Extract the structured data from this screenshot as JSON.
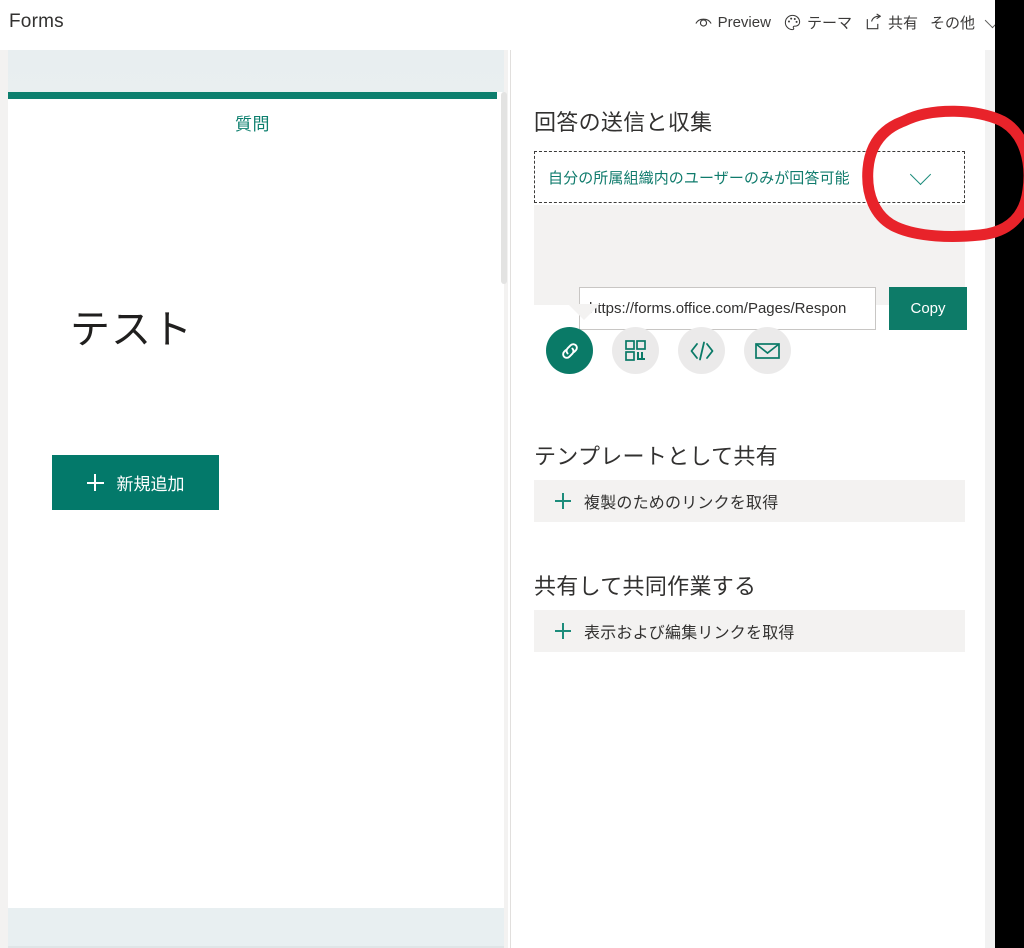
{
  "header": {
    "brand": "Forms",
    "actions": [
      {
        "label": "Preview",
        "icon": "eye-icon"
      },
      {
        "label": "テーマ",
        "icon": "palette-icon"
      },
      {
        "label": "共有",
        "icon": "share-icon"
      },
      {
        "label": "その他",
        "icon": "chevron-down-icon"
      }
    ]
  },
  "form": {
    "tab_label": "質問",
    "title": "テスト",
    "add_button": "新規追加"
  },
  "share_panel": {
    "send_section_title": "回答の送信と収集",
    "audience_value": "自分の所属組織内のユーザーのみが回答可能",
    "link_url": "https://forms.office.com/Pages/Respon",
    "copy_button": "Copy",
    "share_methods": [
      {
        "name": "link-icon",
        "label": "リンク",
        "selected": true
      },
      {
        "name": "qr-code-icon",
        "label": "QR コード",
        "selected": false
      },
      {
        "name": "embed-code-icon",
        "label": "埋め込み",
        "selected": false
      },
      {
        "name": "email-icon",
        "label": "メール",
        "selected": false
      }
    ],
    "template_section_title": "テンプレートとして共有",
    "template_link_label": "複製のためのリンクを取得",
    "collaborate_section_title": "共有して共同作業する",
    "collaborate_link_label": "表示および編集リンクを取得"
  },
  "annotation": {
    "shape": "hand-drawn-red-ellipse",
    "color": "#e8232a",
    "target": "audience-dropdown-chevron"
  },
  "colors": {
    "accent_teal": "#03796a",
    "link_teal": "#0f7b6c",
    "panel_gray": "#f3f2f1",
    "tab_bg": "#e9eff0",
    "annotation_red": "#e8232a"
  }
}
